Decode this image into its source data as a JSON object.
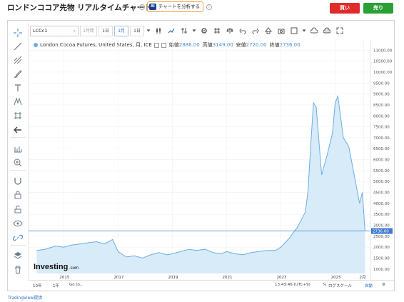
{
  "header": {
    "title": "ロンドンココア先物 リアルタイムチャート",
    "analyze_badge": "AI",
    "analyze_label": "チャートを分析する",
    "sell_label": "買い",
    "buy_label": "売り"
  },
  "toolbar": {
    "symbol": "LCCc1",
    "intervals": [
      "1時間",
      "1日",
      "1月",
      "1日"
    ],
    "active_interval": "1月"
  },
  "legend": {
    "name": "London Cocoa Futures, United States, 月, ICE",
    "open_label": "始値",
    "open_value": "2886.00",
    "high_label": "高値",
    "high_value": "3149.00",
    "low_label": "安値",
    "low_value": "2720.00",
    "close_label": "終値",
    "close_value": "2736.00"
  },
  "chart_data": {
    "type": "area",
    "title": "London Cocoa Futures, United States, 月, ICE",
    "xlabel": "",
    "ylabel": "",
    "ylim": [
      700,
      11500
    ],
    "y_ticks": [
      "11000.00",
      "10500.00",
      "10000.00",
      "9500.00",
      "9000.00",
      "8500.00",
      "8000.00",
      "7500.00",
      "7000.00",
      "6500.00",
      "6000.00",
      "5500.00",
      "5000.00",
      "4500.00",
      "4000.00",
      "3500.00",
      "3000.00",
      "2500.00",
      "2000.00",
      "1500.00",
      "1000.00"
    ],
    "x_ticks": [
      "2015",
      "2017",
      "2019",
      "2021",
      "2023",
      "2025",
      "2月"
    ],
    "last_value": 2736.0,
    "last_label": "2736.00",
    "series": [
      {
        "x": [
          2014.0,
          2014.3,
          2014.7,
          2015.0,
          2015.3,
          2015.6,
          2015.9,
          2016.2,
          2016.5,
          2016.8,
          2017.0,
          2017.3,
          2017.6,
          2017.9,
          2018.2,
          2018.5,
          2018.8,
          2019.0,
          2019.3,
          2019.6,
          2019.9,
          2020.2,
          2020.5,
          2020.8,
          2021.0,
          2021.3,
          2021.6,
          2021.9,
          2022.2,
          2022.5,
          2022.8,
          2023.0,
          2023.3,
          2023.6,
          2023.9,
          2024.0,
          2024.1,
          2024.2,
          2024.3,
          2024.5,
          2024.7,
          2024.9,
          2025.0,
          2025.1,
          2025.3,
          2025.5,
          2025.7,
          2025.9,
          2026.0,
          2026.1
        ],
        "values": [
          1850,
          1900,
          2050,
          2000,
          2100,
          2150,
          2200,
          2250,
          2150,
          2350,
          1800,
          1550,
          1600,
          1500,
          1650,
          1750,
          1650,
          1700,
          1800,
          1900,
          1850,
          1900,
          1750,
          1700,
          1800,
          1700,
          1650,
          1750,
          1800,
          1850,
          1850,
          2000,
          2400,
          2900,
          3600,
          4600,
          6700,
          8600,
          8400,
          5300,
          6200,
          7200,
          8600,
          8900,
          7000,
          6600,
          5300,
          4000,
          4500,
          2736
        ]
      }
    ],
    "grid": true,
    "legend": "top-left",
    "line_color": "#6aaee6",
    "fill_color": "#d8ebf8",
    "last_line_color": "#3d7bd0"
  },
  "bottom_bar": {
    "ranges": [
      "10年",
      "1年",
      "Go to..."
    ],
    "time": "13:43:46 (UTC+9)",
    "percent": "%",
    "log_label": "ログスケール",
    "auto_label": "自動"
  },
  "footer": {
    "text": "TradingView提供"
  }
}
